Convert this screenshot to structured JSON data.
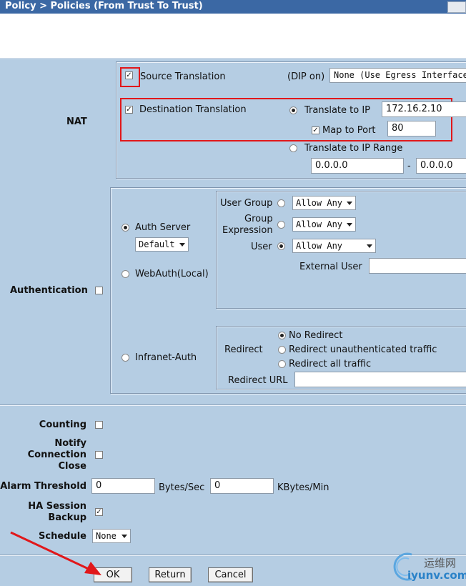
{
  "window": {
    "title": "Policy > Policies (From Trust To Trust)"
  },
  "nat": {
    "section_label": "NAT",
    "source_translation": {
      "label": "Source Translation",
      "checked": true
    },
    "dip_label": "(DIP on)",
    "dip_value": "None (Use Egress Interface",
    "destination_translation": {
      "label": "Destination Translation",
      "checked": true
    },
    "translate_to_ip": {
      "label": "Translate to IP",
      "selected": true,
      "value": "172.16.2.10"
    },
    "map_to_port": {
      "label": "Map to Port",
      "checked": true,
      "value": "80"
    },
    "translate_to_ip_range": {
      "label": "Translate to IP Range",
      "from": "0.0.0.0",
      "dash": "-",
      "to": "0.0.0.0"
    }
  },
  "authentication": {
    "section_label": "Authentication",
    "auth_server": {
      "label": "Auth Server",
      "selected": true,
      "value": "Default"
    },
    "webauth": {
      "label": "WebAuth(Local)"
    },
    "infranet": {
      "label": "Infranet-Auth"
    },
    "user_group": {
      "label": "User Group",
      "value": "Allow Any"
    },
    "group_expression": {
      "label_line1": "Group",
      "label_line2": "Expression",
      "value": "Allow Any"
    },
    "user": {
      "label": "User",
      "value": "Allow Any"
    },
    "external_user": {
      "label": "External User",
      "value": ""
    },
    "redirect": {
      "label": "Redirect",
      "options": [
        "No Redirect",
        "Redirect unauthenticated traffic",
        "Redirect all traffic"
      ],
      "selected": "No Redirect",
      "url_label": "Redirect URL",
      "url_value": ""
    }
  },
  "counting": {
    "label": "Counting"
  },
  "notify": {
    "line1": "Notify",
    "line2": "Connection",
    "line3": "Close"
  },
  "alarm": {
    "label": "Alarm Threshold",
    "bytes_value": "0",
    "bytes_unit": "Bytes/Sec",
    "kbytes_value": "0",
    "kbytes_unit": "KBytes/Min"
  },
  "ha": {
    "line1": "HA Session",
    "line2": "Backup",
    "checked": true
  },
  "schedule": {
    "label": "Schedule",
    "value": "None"
  },
  "buttons": {
    "ok": "OK",
    "return": "Return",
    "cancel": "Cancel"
  },
  "watermark": {
    "brand_cn": "运维网",
    "domain": "iyunv.com"
  },
  "colors": {
    "titlebar": "#3b68a4",
    "panel": "#b5cde3",
    "highlight": "#e1171a"
  }
}
